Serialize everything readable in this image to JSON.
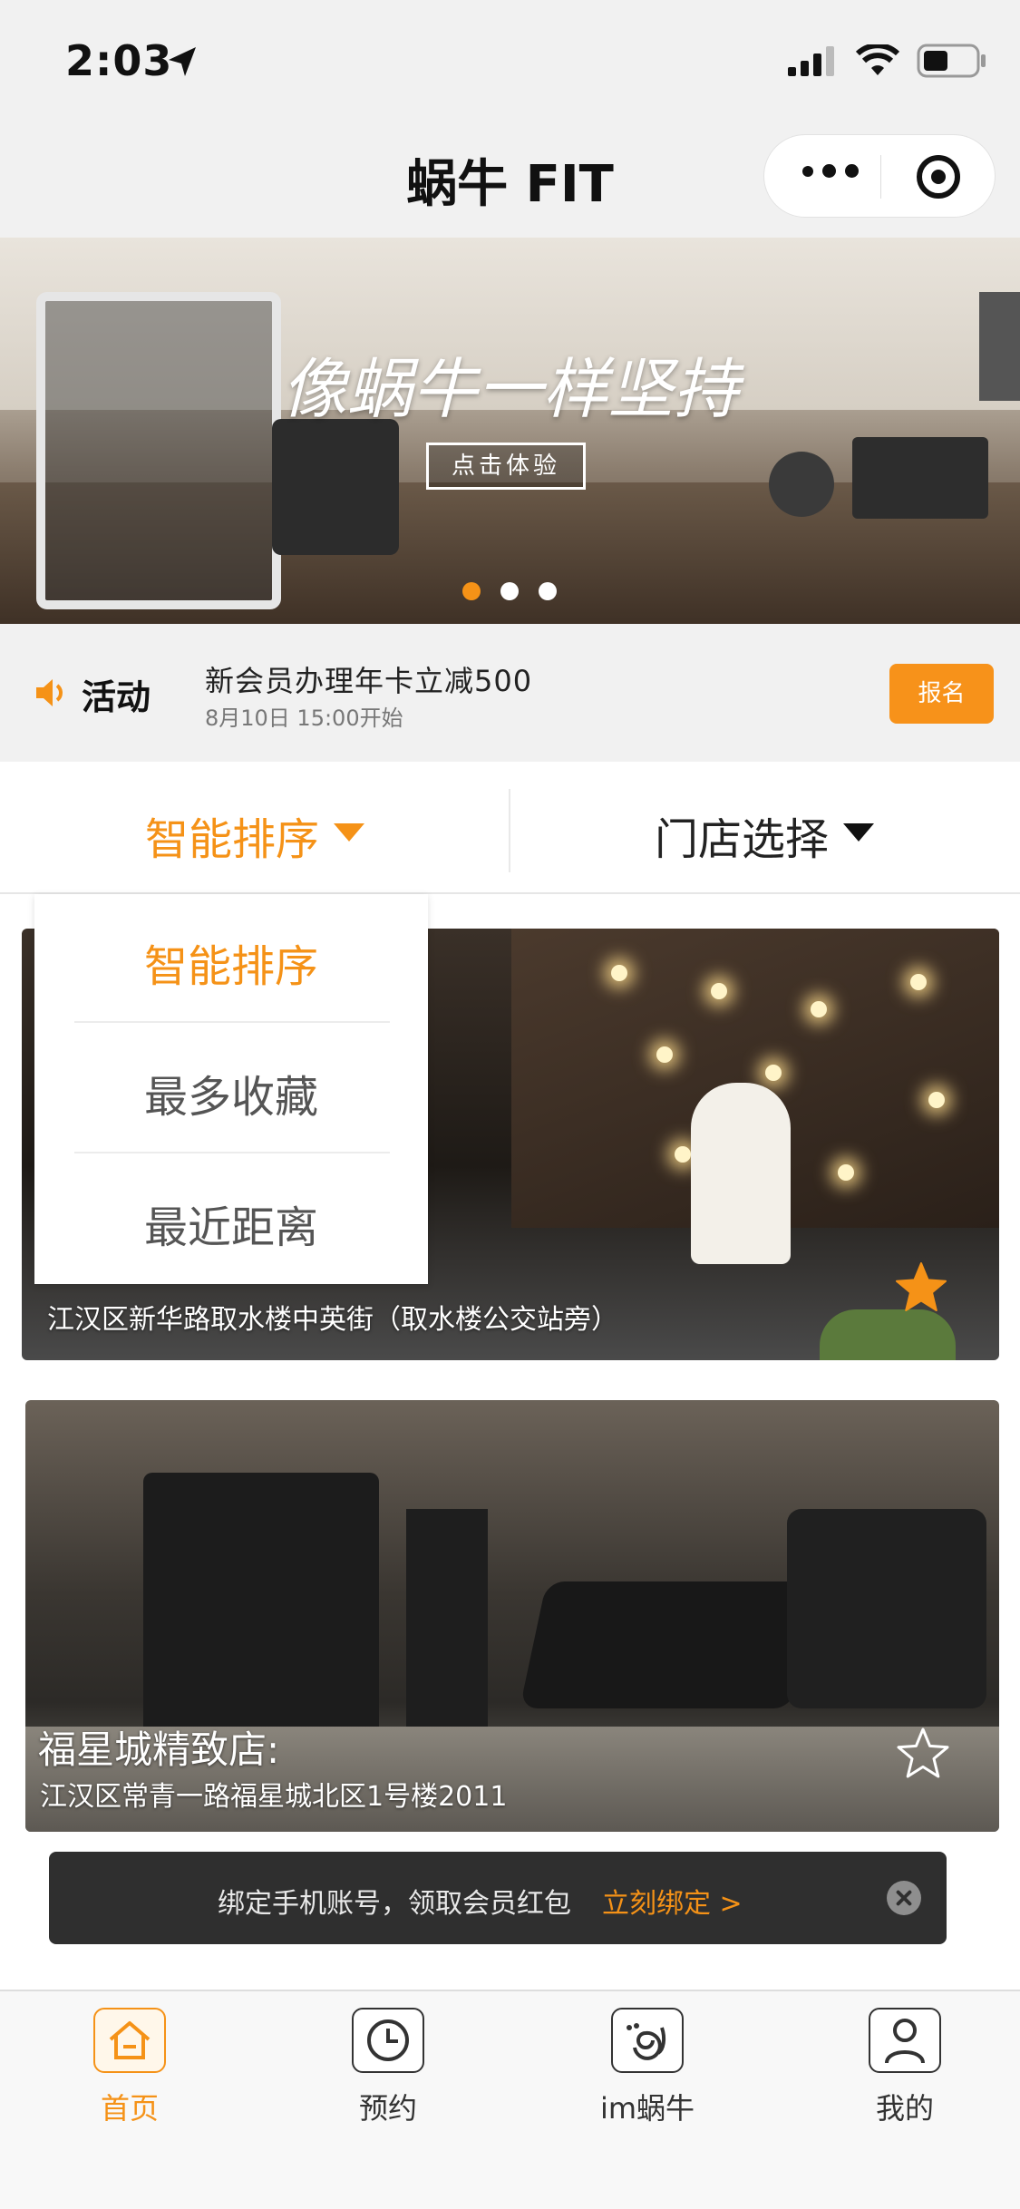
{
  "status_bar": {
    "time": "2:03"
  },
  "nav": {
    "title": "蜗牛 FIT"
  },
  "banner": {
    "slogan": "像蜗牛一样坚持",
    "button_label": "点击体验",
    "slides": 3,
    "active_slide": 1
  },
  "activity": {
    "label": "活动",
    "title": "新会员办理年卡立减500",
    "time": "8月10日 15:00开始",
    "signup_label": "报名"
  },
  "filter": {
    "sort_label": "智能排序",
    "store_label": "门店选择"
  },
  "dropdown": {
    "items": [
      "智能排序",
      "最多收藏",
      "最近距离"
    ],
    "selected": "智能排序"
  },
  "stores": [
    {
      "address": "江汉区新华路取水楼中英街（取水楼公交站旁）",
      "favorited": true
    },
    {
      "name": "福星城精致店:",
      "address": "江汉区常青一路福星城北区1号楼2011",
      "favorited": false
    }
  ],
  "bind_toast": {
    "text": "绑定手机账号，领取会员红包",
    "link": "立刻绑定 >"
  },
  "tabbar": {
    "items": [
      "首页",
      "预约",
      "im蜗牛",
      "我的"
    ],
    "active": "首页"
  },
  "colors": {
    "accent": "#f59217",
    "toast_bg": "#2f2f2f"
  }
}
